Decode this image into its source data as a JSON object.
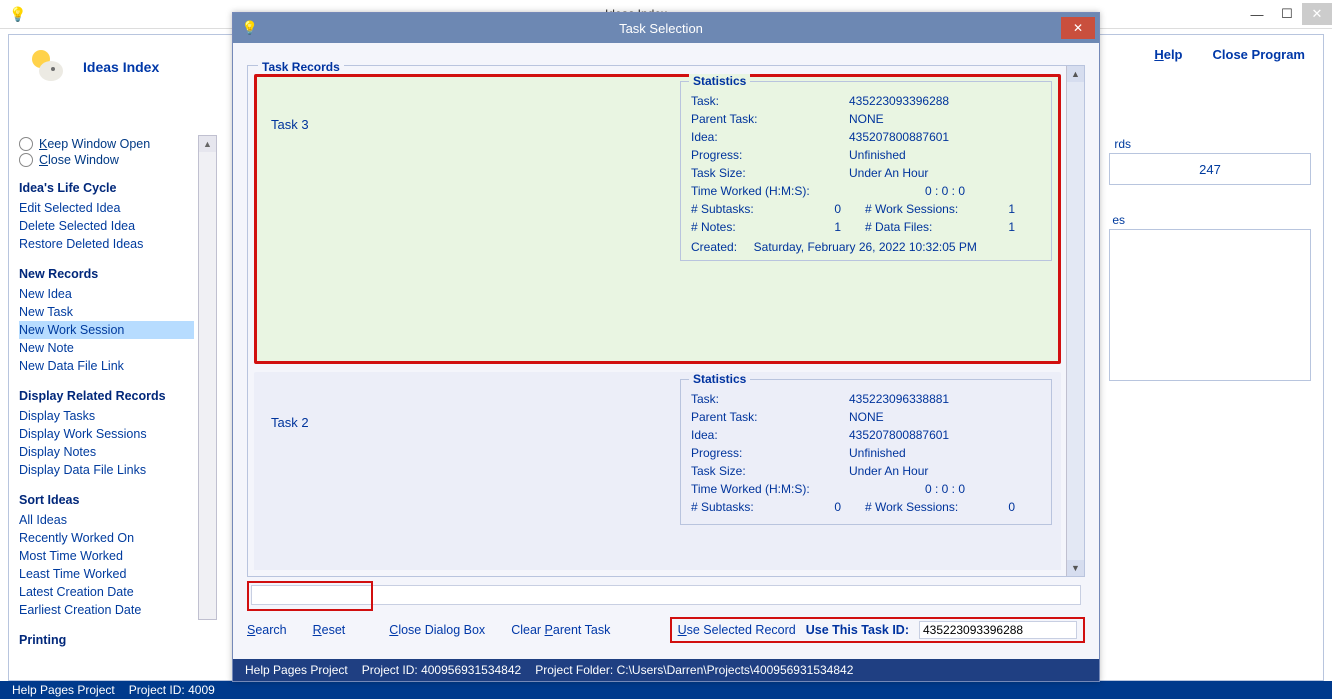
{
  "outer": {
    "title": "Ideas Index",
    "header_title": "Ideas Index",
    "top_links": {
      "help": "Help",
      "close": "Close Program"
    },
    "radios": {
      "keep": "Keep Window Open",
      "close": "Close Window"
    },
    "right": {
      "count": "247"
    },
    "status": {
      "project": "Help Pages Project",
      "project_id_label": "Project ID:",
      "project_id": "4009"
    }
  },
  "sidebar": {
    "life_cycle": {
      "head": "Idea's Life Cycle",
      "edit": "Edit Selected Idea",
      "delete": "Delete Selected Idea",
      "restore": "Restore Deleted Ideas"
    },
    "new_records": {
      "head": "New Records",
      "idea": "New Idea",
      "task": "New Task",
      "session": "New Work Session",
      "note": "New Note",
      "file": "New Data File Link"
    },
    "display": {
      "head": "Display Related Records",
      "tasks": "Display Tasks",
      "sessions": "Display Work Sessions",
      "notes": "Display Notes",
      "files": "Display Data File Links"
    },
    "sort": {
      "head": "Sort Ideas",
      "all": "All Ideas",
      "recent": "Recently Worked On",
      "most": "Most Time Worked",
      "least": "Least Time Worked",
      "latest": "Latest Creation Date",
      "earliest": "Earliest Creation Date"
    },
    "printing": {
      "head": "Printing"
    }
  },
  "dialog": {
    "title": "Task Selection",
    "records_label": "Task Records",
    "stats_label": "Statistics",
    "labels": {
      "task": "Task:",
      "parent": "Parent Task:",
      "idea": "Idea:",
      "progress": "Progress:",
      "size": "Task Size:",
      "time": "Time Worked (H:M:S):",
      "subtasks": "# Subtasks:",
      "sessions": "# Work Sessions:",
      "notes": "# Notes:",
      "files": "# Data Files:",
      "created": "Created:"
    },
    "records": [
      {
        "name": "Task 3",
        "task": "435223093396288",
        "parent": "NONE",
        "idea": "435207800887601",
        "progress": "Unfinished",
        "size": "Under An Hour",
        "time": "0 :  0  :  0",
        "subtasks": "0",
        "sessions": "1",
        "notes": "1",
        "files": "1",
        "created": "Saturday, February 26, 2022   10:32:05 PM"
      },
      {
        "name": "Task 2",
        "task": "435223096338881",
        "parent": "NONE",
        "idea": "435207800887601",
        "progress": "Unfinished",
        "size": "Under An Hour",
        "time": "0 :  0  :  0",
        "subtasks": "0",
        "sessions": "0",
        "notes": "",
        "files": "",
        "created": ""
      }
    ],
    "actions": {
      "search": "Search",
      "reset": "Reset",
      "close": "Close Dialog Box",
      "clear": "Clear Parent Task",
      "use_selected": "Use Selected Record",
      "use_id_label": "Use This Task ID:",
      "use_id_value": "435223093396288"
    },
    "status": {
      "project": "Help Pages Project",
      "project_id": "Project ID:  400956931534842",
      "folder": "Project Folder:  C:\\Users\\Darren\\Projects\\400956931534842"
    }
  }
}
